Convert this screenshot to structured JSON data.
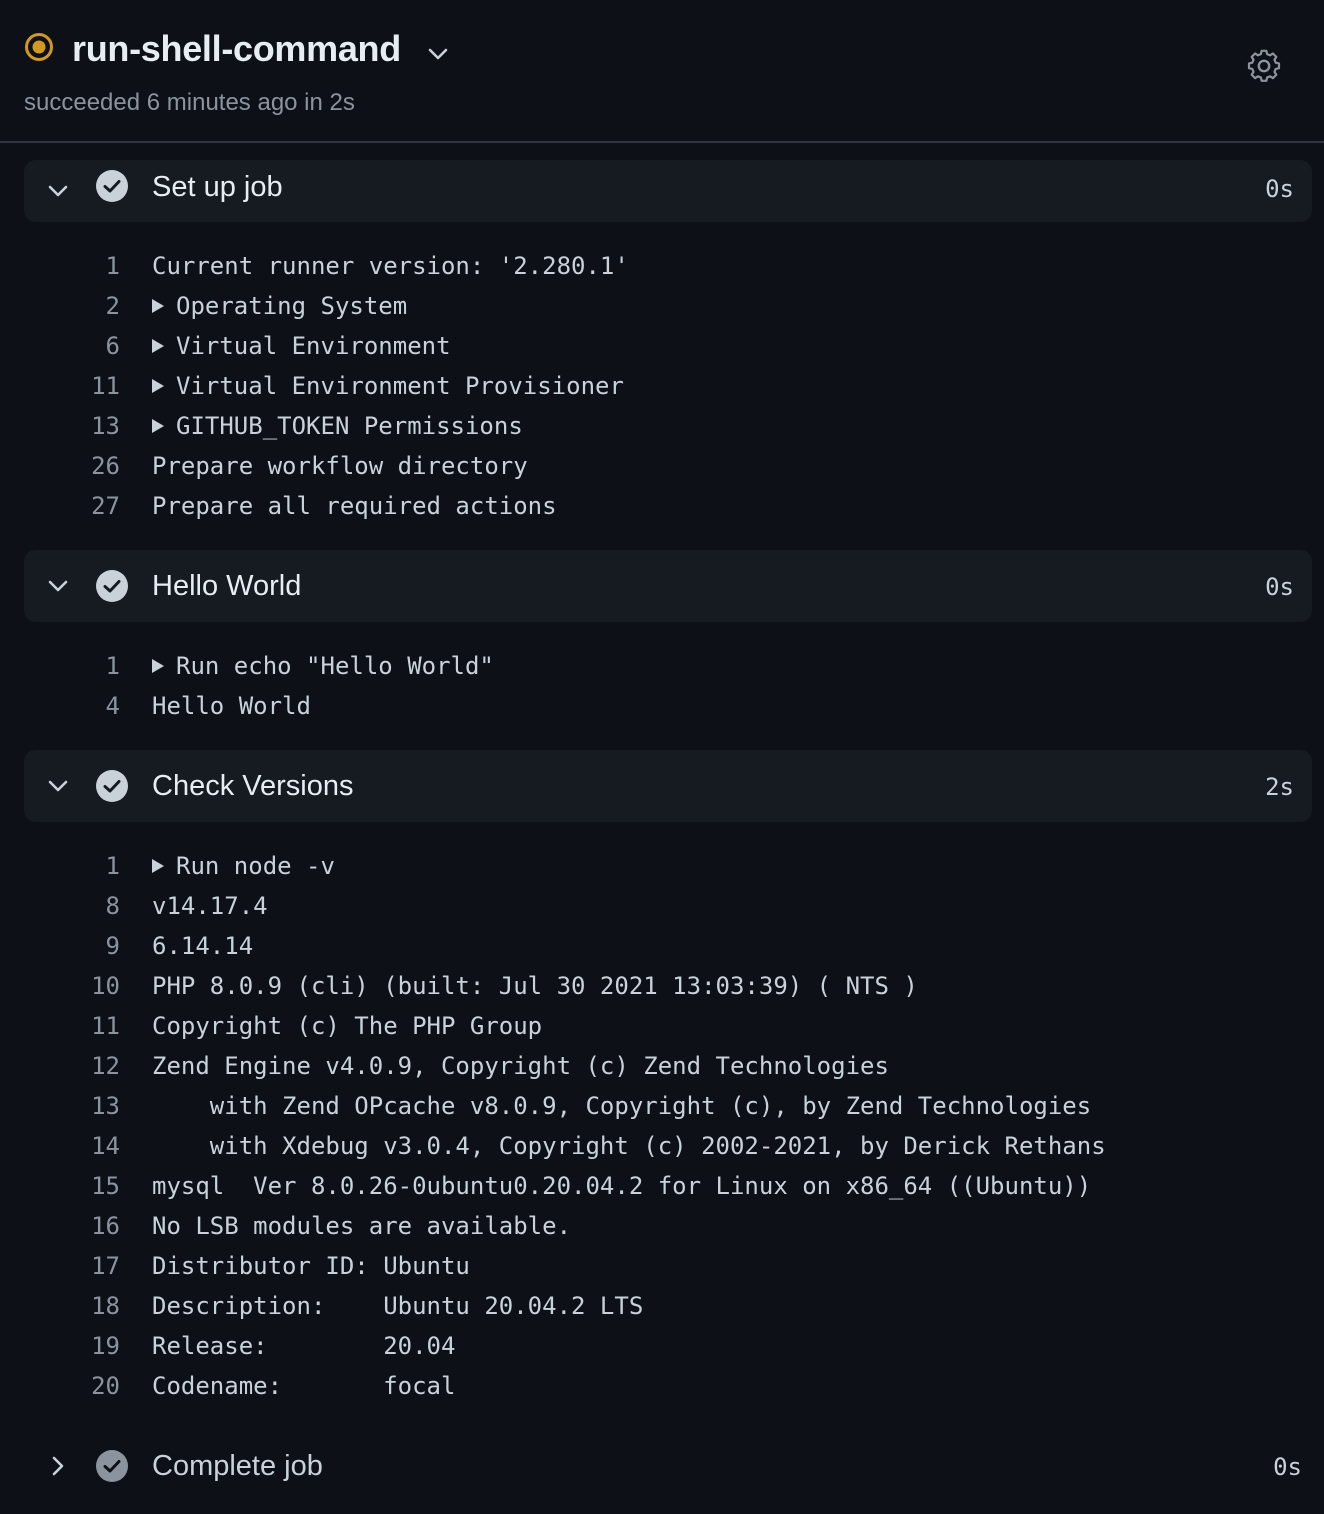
{
  "job": {
    "title": "run-shell-command",
    "meta": "succeeded 6 minutes ago in 2s",
    "status_icon": "status-dot-icon",
    "status_color": "#d29922"
  },
  "colors": {
    "background": "#0d1117",
    "step_header_bg": "#161b22",
    "text": "#c9d1d9",
    "muted": "#8b949e"
  },
  "steps": [
    {
      "title": "Set up job",
      "duration": "0s",
      "expanded": true,
      "lines": [
        {
          "num": "1",
          "text": "Current runner version: '2.280.1'",
          "expandable": false
        },
        {
          "num": "2",
          "text": "Operating System",
          "expandable": true
        },
        {
          "num": "6",
          "text": "Virtual Environment",
          "expandable": true
        },
        {
          "num": "11",
          "text": "Virtual Environment Provisioner",
          "expandable": true
        },
        {
          "num": "13",
          "text": "GITHUB_TOKEN Permissions",
          "expandable": true
        },
        {
          "num": "26",
          "text": "Prepare workflow directory",
          "expandable": false
        },
        {
          "num": "27",
          "text": "Prepare all required actions",
          "expandable": false
        }
      ]
    },
    {
      "title": "Hello World",
      "duration": "0s",
      "expanded": true,
      "lines": [
        {
          "num": "1",
          "text": "Run echo \"Hello World\"",
          "expandable": true
        },
        {
          "num": "4",
          "text": "Hello World",
          "expandable": false
        }
      ]
    },
    {
      "title": "Check Versions",
      "duration": "2s",
      "expanded": true,
      "lines": [
        {
          "num": "1",
          "text": "Run node -v",
          "expandable": true
        },
        {
          "num": "8",
          "text": "v14.17.4",
          "expandable": false
        },
        {
          "num": "9",
          "text": "6.14.14",
          "expandable": false
        },
        {
          "num": "10",
          "text": "PHP 8.0.9 (cli) (built: Jul 30 2021 13:03:39) ( NTS )",
          "expandable": false
        },
        {
          "num": "11",
          "text": "Copyright (c) The PHP Group",
          "expandable": false
        },
        {
          "num": "12",
          "text": "Zend Engine v4.0.9, Copyright (c) Zend Technologies",
          "expandable": false
        },
        {
          "num": "13",
          "text": "    with Zend OPcache v8.0.9, Copyright (c), by Zend Technologies",
          "expandable": false
        },
        {
          "num": "14",
          "text": "    with Xdebug v3.0.4, Copyright (c) 2002-2021, by Derick Rethans",
          "expandable": false
        },
        {
          "num": "15",
          "text": "mysql  Ver 8.0.26-0ubuntu0.20.04.2 for Linux on x86_64 ((Ubuntu))",
          "expandable": false
        },
        {
          "num": "16",
          "text": "No LSB modules are available.",
          "expandable": false
        },
        {
          "num": "17",
          "text": "Distributor ID:\tUbuntu",
          "expandable": false
        },
        {
          "num": "18",
          "text": "Description:\tUbuntu 20.04.2 LTS",
          "expandable": false
        },
        {
          "num": "19",
          "text": "Release:\t20.04",
          "expandable": false
        },
        {
          "num": "20",
          "text": "Codename:\tfocal",
          "expandable": false
        }
      ]
    },
    {
      "title": "Complete job",
      "duration": "0s",
      "expanded": false,
      "lines": []
    }
  ]
}
